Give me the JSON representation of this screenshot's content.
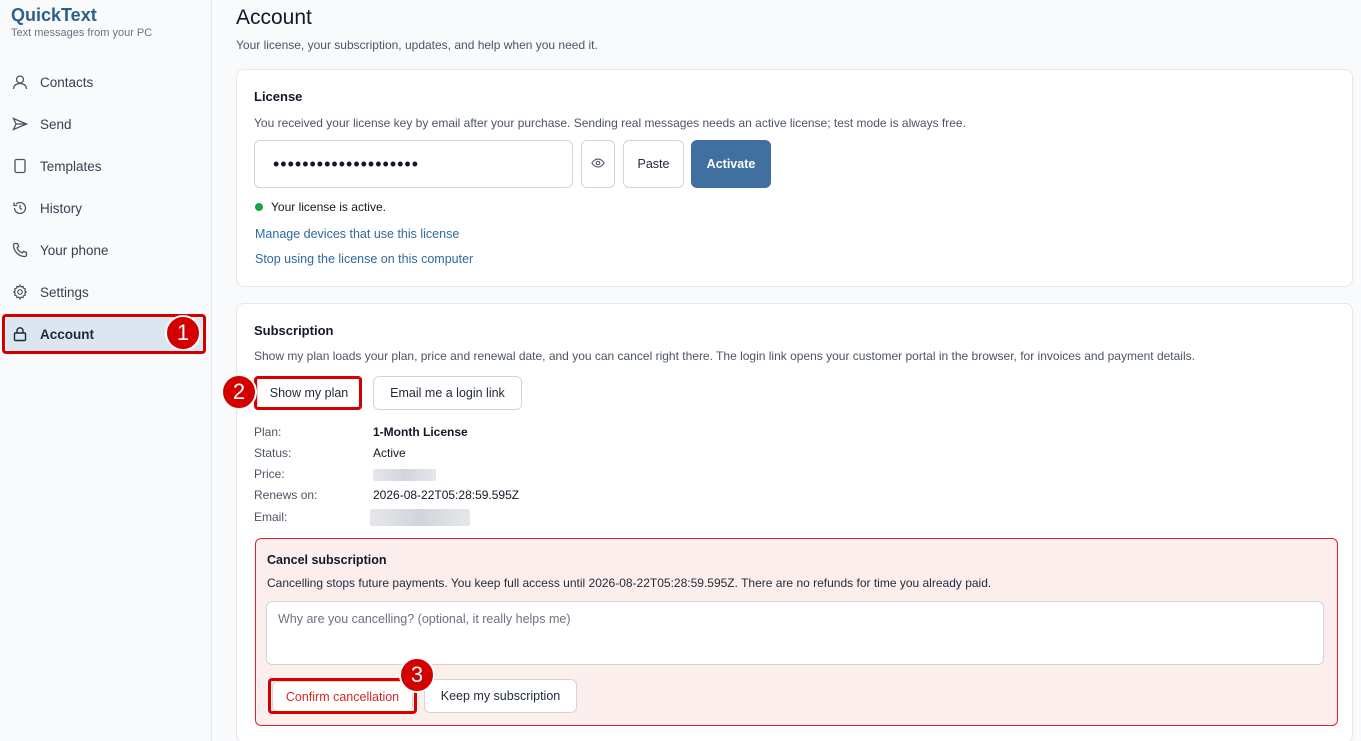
{
  "app": {
    "name": "QuickText",
    "tagline": "Text messages from your PC"
  },
  "sidebar": {
    "items": [
      {
        "label": "Contacts",
        "icon": "user-icon"
      },
      {
        "label": "Send",
        "icon": "send-icon"
      },
      {
        "label": "Templates",
        "icon": "template-icon"
      },
      {
        "label": "History",
        "icon": "history-icon"
      },
      {
        "label": "Your phone",
        "icon": "phone-icon"
      },
      {
        "label": "Settings",
        "icon": "gear-icon"
      },
      {
        "label": "Account",
        "icon": "lock-icon",
        "active": true
      }
    ]
  },
  "page": {
    "title": "Account",
    "subtitle": "Your license, your subscription, updates, and help when you need it."
  },
  "license": {
    "title": "License",
    "description": "You received your license key by email after your purchase. Sending real messages needs an active license; test mode is always free.",
    "key_masked": "••••••••••••••••••••",
    "paste_label": "Paste",
    "activate_label": "Activate",
    "status": "Your license is active.",
    "status_color": "#16a34a",
    "manage_link": "Manage devices that use this license",
    "stop_link": "Stop using the license on this computer"
  },
  "subscription": {
    "title": "Subscription",
    "description": "Show my plan loads your plan, price and renewal date, and you can cancel right there. The login link opens your customer portal in the browser, for invoices and payment details.",
    "show_plan_label": "Show my plan",
    "email_link_label": "Email me a login link",
    "details": {
      "plan_label": "Plan:",
      "plan_value": "1-Month License",
      "status_label": "Status:",
      "status_value": "Active",
      "price_label": "Price:",
      "renews_label": "Renews on:",
      "renews_value": "2026-08-22T05:28:59.595Z",
      "email_label": "Email:"
    },
    "cancel": {
      "title": "Cancel subscription",
      "description": "Cancelling stops future payments. You keep full access until 2026-08-22T05:28:59.595Z. There are no refunds for time you already paid.",
      "reason_placeholder": "Why are you cancelling? (optional, it really helps me)",
      "confirm_label": "Confirm cancellation",
      "keep_label": "Keep my subscription"
    }
  },
  "annotations": [
    "1",
    "2",
    "3"
  ],
  "colors": {
    "brand": "#2d5f8f",
    "primary": "#3f709f",
    "danger": "#dc2626",
    "marker": "#d40000"
  }
}
